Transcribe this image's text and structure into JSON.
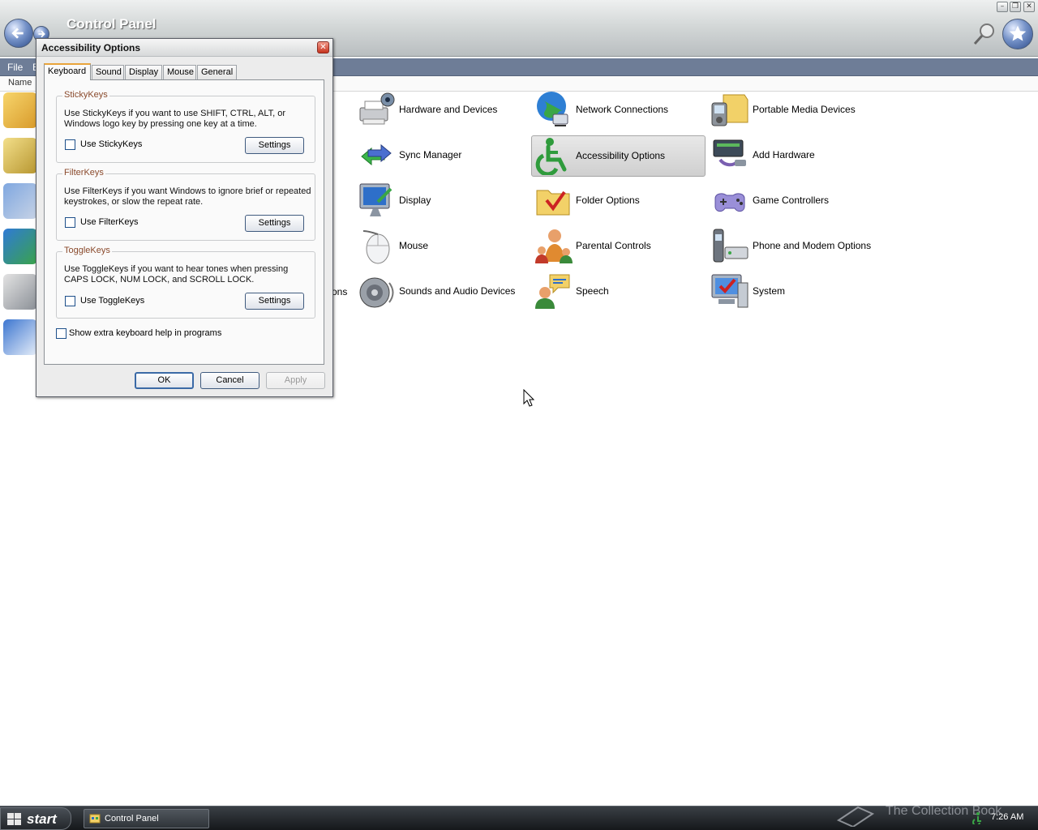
{
  "window": {
    "title": "Control Panel"
  },
  "menu": {
    "items": [
      "File",
      "E"
    ]
  },
  "list_header": {
    "name_col": "Name"
  },
  "partial_text": "ons",
  "control_panel_items": [
    {
      "label": "Hardware and Devices",
      "icon": "printer-camera-icon"
    },
    {
      "label": "Network Connections",
      "icon": "globe-network-icon"
    },
    {
      "label": "Portable Media Devices",
      "icon": "portable-media-icon"
    },
    {
      "label": "Sync Manager",
      "icon": "sync-arrows-icon"
    },
    {
      "label": "Accessibility Options",
      "icon": "wheelchair-icon",
      "selected": true
    },
    {
      "label": "Add Hardware",
      "icon": "add-hardware-icon"
    },
    {
      "label": "Display",
      "icon": "display-monitor-icon"
    },
    {
      "label": "Folder Options",
      "icon": "folder-check-icon"
    },
    {
      "label": "Game Controllers",
      "icon": "gamepad-icon"
    },
    {
      "label": "Mouse",
      "icon": "mouse-icon"
    },
    {
      "label": "Parental Controls",
      "icon": "family-icon"
    },
    {
      "label": "Phone and Modem Options",
      "icon": "phone-modem-icon"
    },
    {
      "label": "Sounds and Audio Devices",
      "icon": "speaker-icon"
    },
    {
      "label": "Speech",
      "icon": "speech-bubble-icon"
    },
    {
      "label": "System",
      "icon": "system-monitor-check-icon"
    }
  ],
  "dialog": {
    "title": "Accessibility Options",
    "tabs": [
      "Keyboard",
      "Sound",
      "Display",
      "Mouse",
      "General"
    ],
    "active_tab": "Keyboard",
    "groups": [
      {
        "title": "StickyKeys",
        "description": "Use StickyKeys if you want to use SHIFT, CTRL, ALT, or Windows logo key by pressing one key at a time.",
        "checkbox_label": "Use StickyKeys",
        "checked": false,
        "button": "Settings"
      },
      {
        "title": "FilterKeys",
        "description": "Use FilterKeys if you want Windows to ignore brief or repeated keystrokes, or slow the repeat rate.",
        "checkbox_label": "Use FilterKeys",
        "checked": false,
        "button": "Settings"
      },
      {
        "title": "ToggleKeys",
        "description": "Use ToggleKeys if you want to hear tones when pressing CAPS LOCK, NUM LOCK, and SCROLL LOCK.",
        "checkbox_label": "Use ToggleKeys",
        "checked": false,
        "button": "Settings"
      }
    ],
    "extra_help": {
      "label": "Show extra keyboard help in programs",
      "checked": false
    },
    "buttons": {
      "ok": "OK",
      "cancel": "Cancel",
      "apply": "Apply"
    }
  },
  "taskbar": {
    "start": "start",
    "task": "Control Panel",
    "clock": "7:26 AM",
    "watermark": "The Collection Book"
  },
  "colors": {
    "menubar": "#6e7d97",
    "accent_tab": "#e9a43b",
    "taskbar": "#15181b"
  }
}
